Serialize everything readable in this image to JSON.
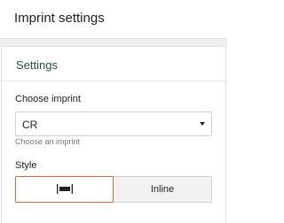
{
  "header": {
    "title": "Imprint settings"
  },
  "panel": {
    "title": "Settings",
    "imprint_field": {
      "label": "Choose imprint",
      "value": "CR",
      "help": "Choose an imprint"
    },
    "style_field": {
      "label": "Style",
      "options": [
        {
          "icon": "block-style-icon",
          "selected": true
        },
        {
          "label": "Inline",
          "selected": false
        }
      ]
    }
  },
  "colors": {
    "selected_border": "#d4693a",
    "panel_title": "#2a4b4b"
  }
}
